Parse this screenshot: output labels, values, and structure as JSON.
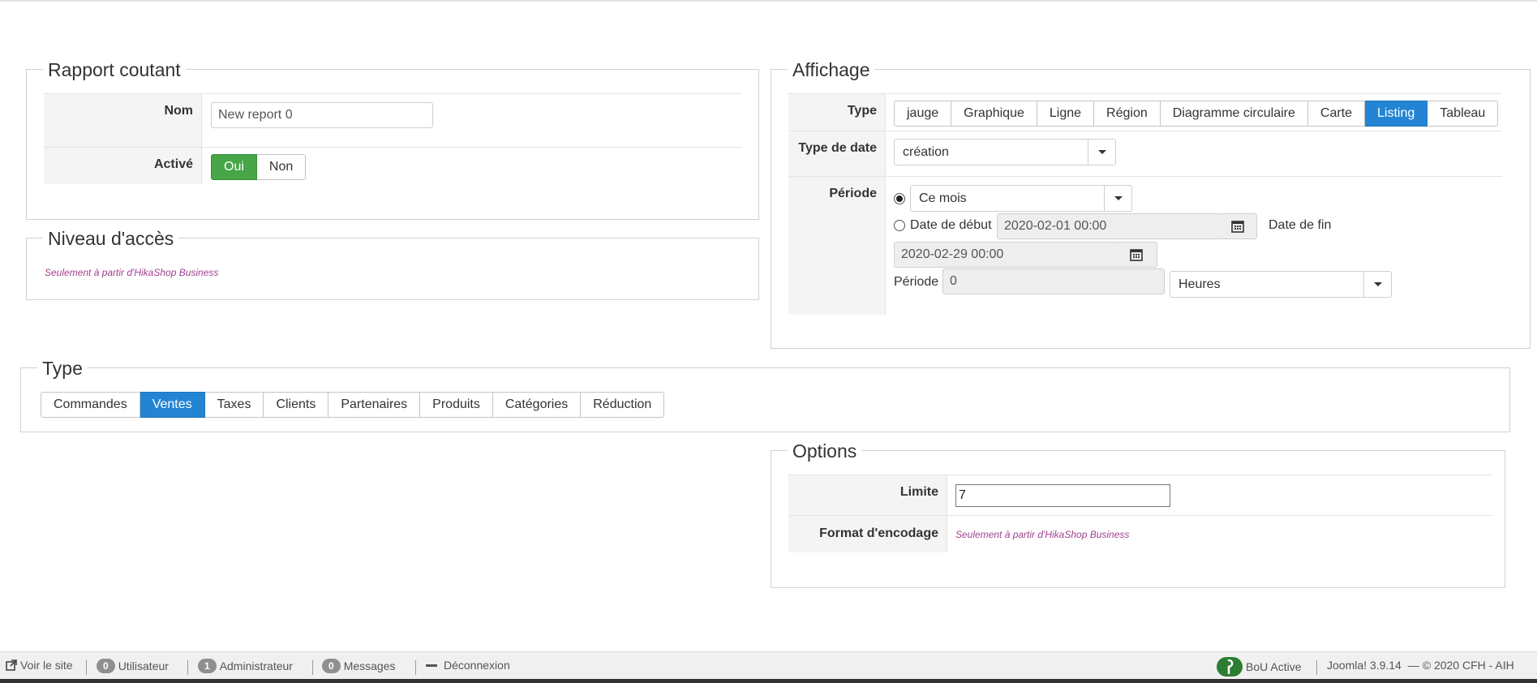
{
  "rapport": {
    "legend": "Rapport coutant",
    "nom_label": "Nom",
    "nom_value": "New report 0",
    "active_label": "Activé",
    "oui": "Oui",
    "non": "Non"
  },
  "acces": {
    "legend": "Niveau d'accès",
    "note": "Seulement à partir d'HikaShop Business"
  },
  "affichage": {
    "legend": "Affichage",
    "type_label": "Type",
    "type_options": [
      "jauge",
      "Graphique",
      "Ligne",
      "Région",
      "Diagramme circulaire",
      "Carte",
      "Listing",
      "Tableau"
    ],
    "type_selected": "Listing",
    "date_type_label": "Type de date",
    "date_type_value": "création",
    "periode_label": "Période",
    "periode_select": "Ce mois",
    "date_debut_label": "Date de début",
    "date_debut_value": "2020-02-01 00:00",
    "date_fin_label": "Date de fin",
    "date_fin_value": "2020-02-29 00:00",
    "periode_inline_label": "Période",
    "periode_value": "0",
    "periode_unit": "Heures"
  },
  "type_section": {
    "legend": "Type",
    "options": [
      "Commandes",
      "Ventes",
      "Taxes",
      "Clients",
      "Partenaires",
      "Produits",
      "Catégories",
      "Réduction"
    ],
    "selected": "Ventes"
  },
  "options": {
    "legend": "Options",
    "limite_label": "Limite",
    "limite_value": "7",
    "format_label": "Format d'encodage",
    "format_note": "Seulement à partir d'HikaShop Business"
  },
  "statusbar": {
    "voir_site": "Voir le site",
    "utilisateur_count": "0",
    "utilisateur": "Utilisateur",
    "admin_count": "1",
    "administrateur": "Administrateur",
    "messages_count": "0",
    "messages": "Messages",
    "deconnexion": "Déconnexion",
    "bou": "BoU Active",
    "version": "Joomla! 3.9.14",
    "copyright": "— © 2020 CFH - AIH"
  },
  "colors": {
    "accent_blue": "#2384d3",
    "accent_green": "#46a546",
    "note_purple": "#a23f91"
  }
}
